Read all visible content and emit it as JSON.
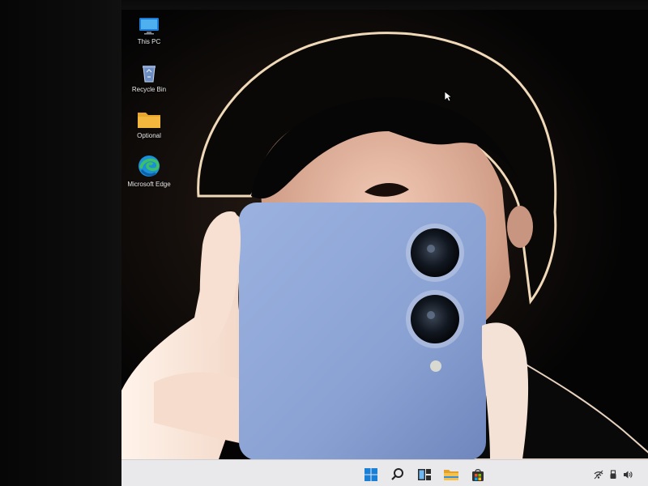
{
  "desktop": {
    "icons": [
      {
        "label": "This PC",
        "icon": "monitor-icon"
      },
      {
        "label": "Recycle Bin",
        "icon": "recycle-bin-icon"
      },
      {
        "label": "Optional",
        "icon": "folder-icon"
      },
      {
        "label": "Microsoft Edge",
        "icon": "edge-icon"
      }
    ]
  },
  "taskbar": {
    "items": [
      {
        "name": "start",
        "icon": "windows-start-icon"
      },
      {
        "name": "search",
        "icon": "search-icon"
      },
      {
        "name": "task-view",
        "icon": "task-view-icon"
      },
      {
        "name": "file-explorer",
        "icon": "folder-icon"
      },
      {
        "name": "store",
        "icon": "store-icon"
      }
    ],
    "tray": [
      {
        "name": "network",
        "icon": "network-icon"
      },
      {
        "name": "usb",
        "icon": "usb-icon"
      },
      {
        "name": "volume",
        "icon": "speaker-icon"
      }
    ]
  },
  "colors": {
    "taskbar_bg": "#e9e9ec",
    "wallpaper_bg": "#040404",
    "phone_blue": "#8fa7d6",
    "folder_yellow": "#f4b73e",
    "edge_blue": "#1b8fd8",
    "edge_green": "#3cbf66",
    "start_blue": "#1a7fd6"
  }
}
